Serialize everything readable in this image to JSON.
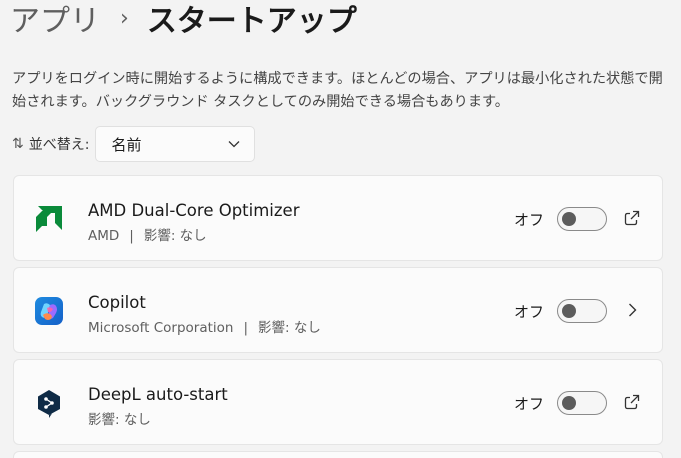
{
  "breadcrumb": {
    "parent": "アプリ",
    "separator": "›",
    "current": "スタートアップ"
  },
  "description": "アプリをログイン時に開始するように構成できます。ほとんどの場合、アプリは最小化された状態で開始されます。バックグラウンド タスクとしてのみ開始できる場合もあります。",
  "sort": {
    "icon": "sort-arrows-icon",
    "label": "並べ替え:",
    "value": "名前"
  },
  "apps": [
    {
      "name": "AMD Dual-Core Optimizer",
      "publisher": "AMD",
      "separator": "|",
      "impact": "影響: なし",
      "state": "オフ",
      "enabled": false,
      "icon": "amd-logo-icon",
      "action": "open-external-icon"
    },
    {
      "name": "Copilot",
      "publisher": "Microsoft Corporation",
      "separator": "|",
      "impact": "影響: なし",
      "state": "オフ",
      "enabled": false,
      "icon": "copilot-logo-icon",
      "action": "chevron-right-icon"
    },
    {
      "name": "DeepL auto-start",
      "impact": "影響: なし",
      "state": "オフ",
      "enabled": false,
      "icon": "deepl-logo-icon",
      "action": "open-external-icon"
    }
  ],
  "colors": {
    "background": "#f3f3f3",
    "card": "#fbfbfb",
    "amd_green": "#0a8a3a",
    "deepl_navy": "#0f2b46"
  }
}
